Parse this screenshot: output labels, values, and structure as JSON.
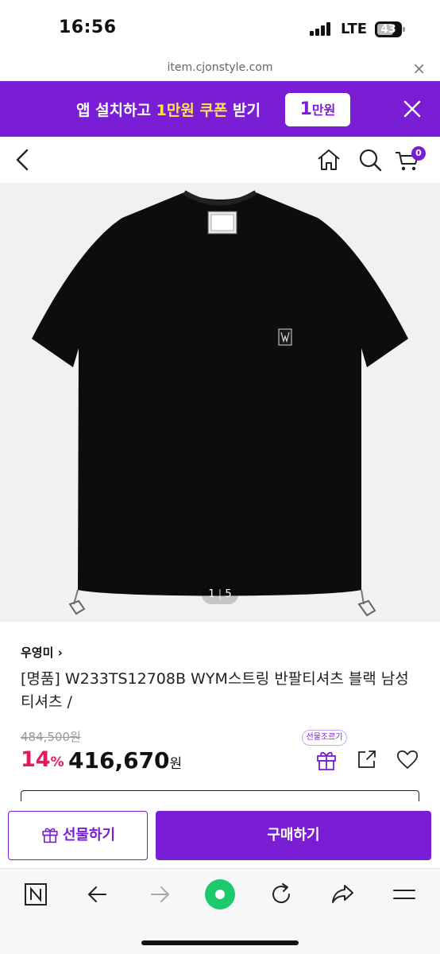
{
  "status_bar": {
    "time": "16:56",
    "network": "LTE",
    "battery": "43"
  },
  "browser": {
    "url": "item.cjonstyle.com"
  },
  "promo": {
    "text_prefix": "앱 설치하고 ",
    "text_highlight": "1만원 쿠폰",
    "text_suffix": " 받기",
    "chip_amount": "1",
    "chip_unit": "만원"
  },
  "header": {
    "cart_count": "0"
  },
  "gallery": {
    "current": "1",
    "separator": "|",
    "total": "5"
  },
  "product": {
    "brand": "우영미 ›",
    "title": "[명품] W233TS12708B WYM스트링 반팔티셔츠 블랙 남성 티셔츠 /",
    "original_price": "484,500원",
    "discount_rate": "14",
    "discount_unit": "%",
    "price": "416,670",
    "price_unit": "원",
    "gift_tooltip": "선물조르기"
  },
  "actions": {
    "gift_button": "선물하기",
    "buy_button": "구매하기"
  },
  "colors": {
    "brand_purple": "#7a1ed6",
    "discount_red": "#e6195a",
    "highlight_yellow": "#ffe650"
  }
}
